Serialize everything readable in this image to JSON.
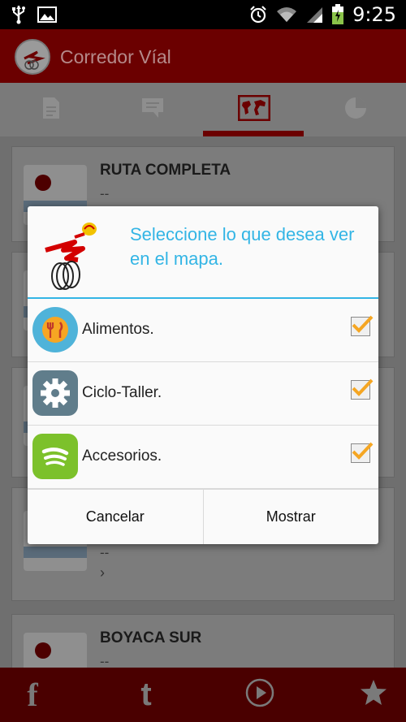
{
  "status_bar": {
    "time": "9:25",
    "icons": [
      "usb-icon",
      "image-icon",
      "alarm-icon",
      "wifi-icon",
      "signal-icon",
      "battery-charging-icon"
    ]
  },
  "app_bar": {
    "title": "Corredor Víal",
    "logo_icon": "cycling-logo-icon"
  },
  "tabs": [
    {
      "icon": "document-icon"
    },
    {
      "icon": "comment-icon"
    },
    {
      "icon": "world-map-icon",
      "selected": true
    },
    {
      "icon": "pie-chart-icon"
    }
  ],
  "list": {
    "items": [
      {
        "title": "RUTA COMPLETA",
        "subtitle": "--"
      },
      {
        "title": "",
        "subtitle": ""
      },
      {
        "title": "",
        "subtitle": ""
      },
      {
        "title": "",
        "subtitle": "--"
      },
      {
        "title": "BOYACA SUR",
        "subtitle": "--"
      }
    ]
  },
  "dialog": {
    "title": "Seleccione lo que desea ver en el mapa.",
    "options": [
      {
        "label": "Alimentos.",
        "icon": "food-icon",
        "checked": true,
        "color": "#4fb3d9"
      },
      {
        "label": "Ciclo-Taller.",
        "icon": "gear-icon",
        "checked": true,
        "color": "#607d8b"
      },
      {
        "label": "Accesorios.",
        "icon": "accessories-icon",
        "checked": true,
        "color": "#7cc12b"
      }
    ],
    "buttons": {
      "cancel": "Cancelar",
      "confirm": "Mostrar"
    }
  },
  "bottom_bar": [
    {
      "icon": "facebook-icon",
      "glyph": "f"
    },
    {
      "icon": "tumblr-icon",
      "glyph": "t"
    },
    {
      "icon": "play-icon"
    },
    {
      "icon": "star-icon"
    }
  ],
  "colors": {
    "accent": "#33b5e5",
    "brand": "#d30000",
    "check": "#f5a623"
  }
}
